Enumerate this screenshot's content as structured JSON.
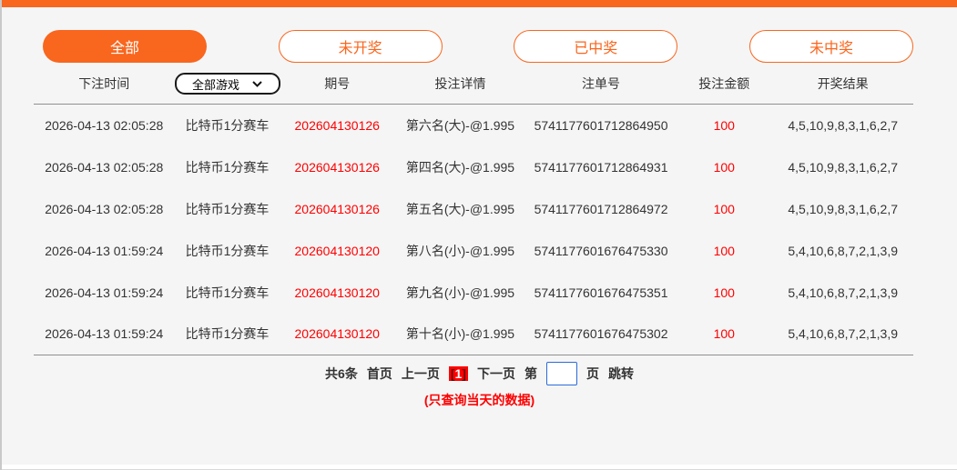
{
  "theme": {
    "accent_orange": "#f9661e",
    "alert_red": "#ff0000",
    "text_dark": "#333333",
    "page_bg": "#f5f5f5",
    "input_border_blue": "#2b6bd8"
  },
  "filters": {
    "all": "全部",
    "not_drawn": "未开奖",
    "won": "已中奖",
    "not_won": "未中奖",
    "active": "全部"
  },
  "game_select": {
    "value": "全部游戏"
  },
  "table": {
    "headers": {
      "time": "下注时间",
      "period": "期号",
      "detail": "投注详情",
      "order": "注单号",
      "amount": "投注金额",
      "result": "开奖结果"
    },
    "rows": [
      {
        "time": "2026-04-13 02:05:28",
        "game": "比特币1分赛车",
        "period": "202604130126",
        "detail": "第六名(大)-@1.995",
        "order": "5741177601712864950",
        "amount": "100",
        "result": "4,5,10,9,8,3,1,6,2,7"
      },
      {
        "time": "2026-04-13 02:05:28",
        "game": "比特币1分赛车",
        "period": "202604130126",
        "detail": "第四名(大)-@1.995",
        "order": "5741177601712864931",
        "amount": "100",
        "result": "4,5,10,9,8,3,1,6,2,7"
      },
      {
        "time": "2026-04-13 02:05:28",
        "game": "比特币1分赛车",
        "period": "202604130126",
        "detail": "第五名(大)-@1.995",
        "order": "5741177601712864972",
        "amount": "100",
        "result": "4,5,10,9,8,3,1,6,2,7"
      },
      {
        "time": "2026-04-13 01:59:24",
        "game": "比特币1分赛车",
        "period": "202604130120",
        "detail": "第八名(小)-@1.995",
        "order": "5741177601676475330",
        "amount": "100",
        "result": "5,4,10,6,8,7,2,1,3,9"
      },
      {
        "time": "2026-04-13 01:59:24",
        "game": "比特币1分赛车",
        "period": "202604130120",
        "detail": "第九名(小)-@1.995",
        "order": "5741177601676475351",
        "amount": "100",
        "result": "5,4,10,6,8,7,2,1,3,9"
      },
      {
        "time": "2026-04-13 01:59:24",
        "game": "比特币1分赛车",
        "period": "202604130120",
        "detail": "第十名(小)-@1.995",
        "order": "5741177601676475302",
        "amount": "100",
        "result": "5,4,10,6,8,7,2,1,3,9"
      }
    ]
  },
  "pagination": {
    "total": "共6条",
    "first": "首页",
    "prev": "上一页",
    "current_open": "[",
    "current_page": "1",
    "current_close": "]",
    "next": "下一页",
    "jump_prefix": "第",
    "input_value": "",
    "jump_suffix": "页",
    "jump_action": "跳转"
  },
  "note": "(只查询当天的数据)"
}
